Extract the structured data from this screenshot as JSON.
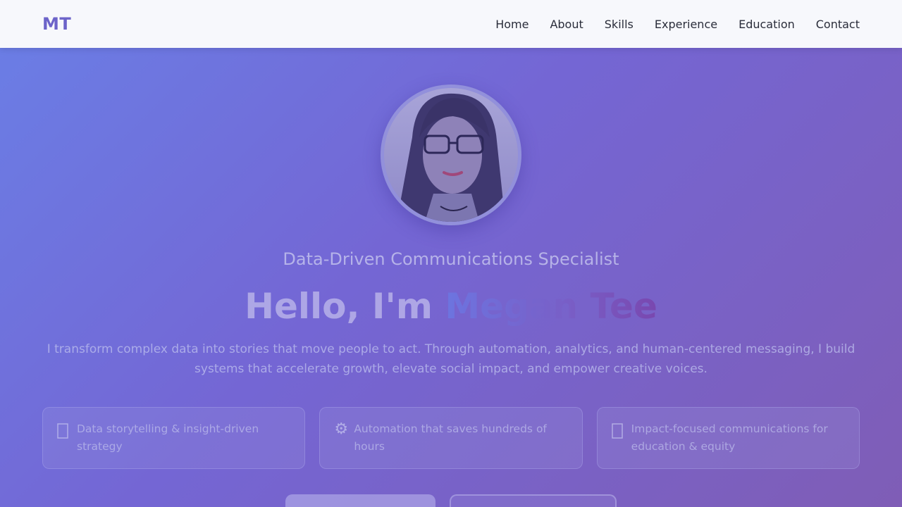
{
  "nav": {
    "logo": "MT",
    "links": [
      "Home",
      "About",
      "Skills",
      "Experience",
      "Education",
      "Contact"
    ]
  },
  "hero": {
    "subtitle": "Data-Driven Communications Specialist",
    "greeting": "Hello, I'm ",
    "name": "Megan Tee",
    "intro": "I transform complex data into stories that move people to act. Through automation, analytics, and human-centered messaging, I build systems that accelerate growth, elevate social impact, and empower creative voices.",
    "cards": [
      {
        "icon": "chart-icon",
        "text": "Data storytelling & insight-driven strategy"
      },
      {
        "icon": "gear-icon",
        "text": "Automation that saves hundreds of hours"
      },
      {
        "icon": "target-icon",
        "text": "Impact-focused communications for education & equity"
      }
    ],
    "buttons": {
      "primary": "",
      "secondary": ""
    }
  },
  "colors": {
    "accent": "#6c63c9",
    "gradient_start": "#6a7fe6",
    "gradient_end": "#7f5db6",
    "nav_bg": "#f7f8fc"
  }
}
